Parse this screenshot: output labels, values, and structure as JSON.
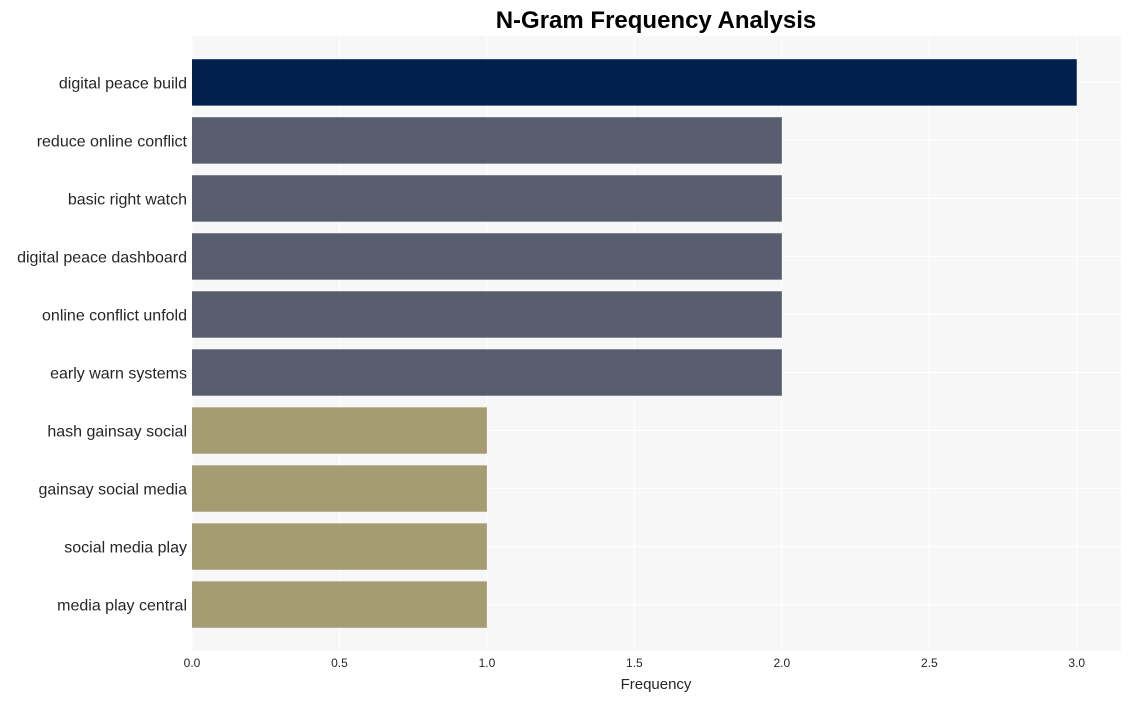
{
  "chart_data": {
    "type": "bar",
    "orientation": "horizontal",
    "title": "N-Gram Frequency Analysis",
    "xlabel": "Frequency",
    "ylabel": "",
    "xlim": [
      0,
      3.15
    ],
    "xticks": [
      0.0,
      0.5,
      1.0,
      1.5,
      2.0,
      2.5,
      3.0
    ],
    "xtick_labels": [
      "0.0",
      "0.5",
      "1.0",
      "1.5",
      "2.0",
      "2.5",
      "3.0"
    ],
    "grid": true,
    "categories": [
      "digital peace build",
      "reduce online conflict",
      "basic right watch",
      "digital peace dashboard",
      "online conflict unfold",
      "early warn systems",
      "hash gainsay social",
      "gainsay social media",
      "social media play",
      "media play central"
    ],
    "values": [
      3,
      2,
      2,
      2,
      2,
      2,
      1,
      1,
      1,
      1
    ],
    "colors": {
      "3": "#00214d",
      "2": "#575d6d",
      "1": "#a59c74"
    },
    "background": "#f7f7f7",
    "gridline_color": "#ffffff"
  }
}
